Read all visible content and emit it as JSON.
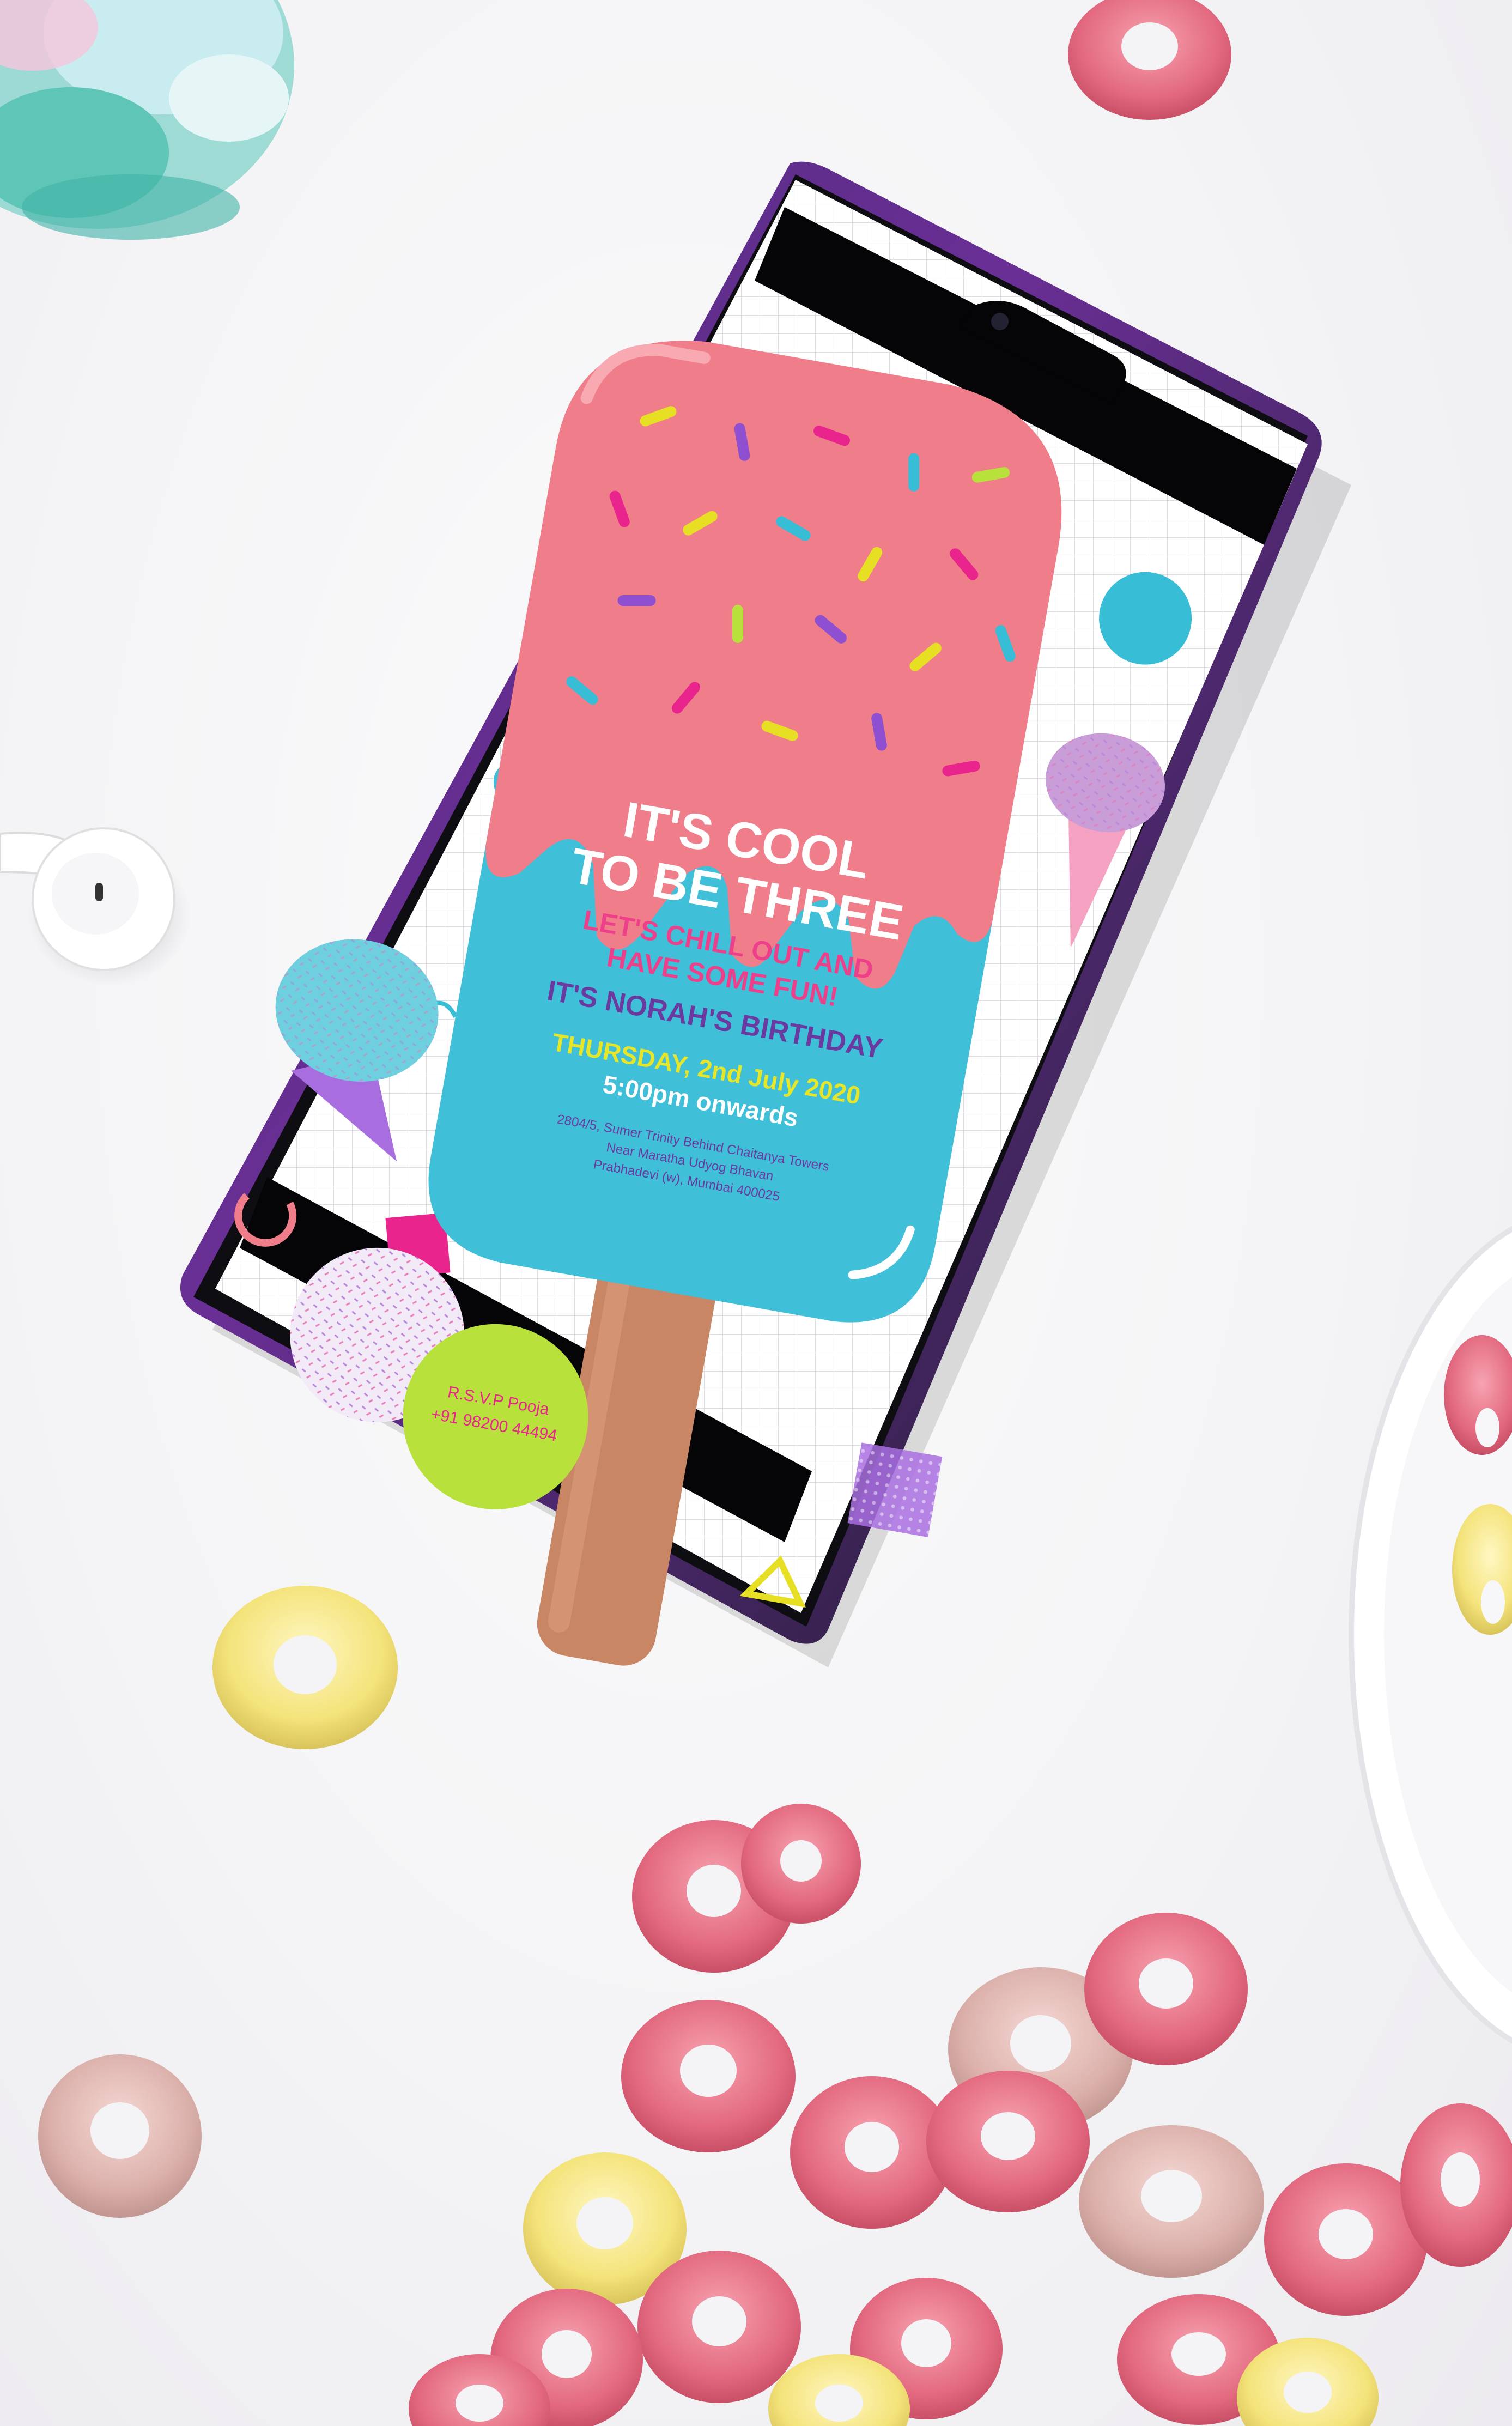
{
  "invitation": {
    "headline_line1": "IT'S COOL",
    "headline_line2": "TO BE THREE",
    "subline_line1": "LET'S CHILL OUT AND",
    "subline_line2": "HAVE SOME FUN!",
    "birthday_line": "IT'S NORAH'S BIRTHDAY",
    "date_line": "THURSDAY, 2nd July 2020",
    "time_line": "5:00pm onwards",
    "address_line1": "2804/5, Sumer Trinity Behind Chaitanya Towers",
    "address_line2": "Near Maratha Udyog Bhavan",
    "address_line3": "Prabhadevi (w), Mumbai 400025",
    "rsvp_label": "R.S.V.P Pooja",
    "rsvp_phone": "+91 98200 44494"
  },
  "colors": {
    "background": "#f4f4f6",
    "phone_body": "#111111",
    "phone_edge": "#5b2b86",
    "icecream_pink": "#f07e8a",
    "icecream_blue": "#3fbfd8",
    "stick": "#c98665",
    "headline": "#ffffff",
    "subline": "#ee3f8b",
    "birthday": "#6b3aa0",
    "date": "#e5e52a",
    "rsvp_circle": "#b9e13c",
    "cereal_pink": "#e86f86",
    "cereal_yellow": "#f4e67a"
  }
}
